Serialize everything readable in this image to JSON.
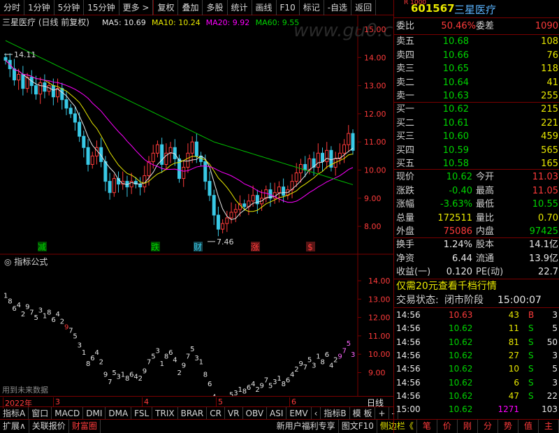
{
  "toolbar": {
    "tabs": [
      "分时",
      "1分钟",
      "5分钟",
      "15分钟",
      "更多 >"
    ],
    "tools": [
      "复权",
      "叠加",
      "多股",
      "统计",
      "画线",
      "F10",
      "标记",
      "-自选",
      "返回"
    ]
  },
  "main_chart": {
    "title": "三星医疗 (日线 前复权)",
    "ma_labels": [
      {
        "text": "MA5: 10.69",
        "color": "#e8e8e8"
      },
      {
        "text": "MA10: 10.24",
        "color": "#e8e800"
      },
      {
        "text": "MA20: 9.92",
        "color": "#ff00ff"
      },
      {
        "text": "MA60: 9.55",
        "color": "#00d400"
      }
    ],
    "y_ticks": [
      "15.00",
      "14.00",
      "13.00",
      "12.00",
      "11.00",
      "10.00",
      "9.00",
      "8.00"
    ],
    "high_label": "14.11",
    "low_label": "7.46",
    "markers": [
      "减",
      "跌",
      "财",
      "涨",
      "$"
    ],
    "watermark": "www.gu0.cn"
  },
  "indicator": {
    "title": "指标公式",
    "y_ticks": [
      "14.00",
      "13.00",
      "12.00",
      "11.00",
      "10.00",
      "9.00"
    ],
    "footer_note": "用到未来数据"
  },
  "x_axis": [
    "2022年",
    "3",
    "4",
    "5",
    "6"
  ],
  "x_right": "日线",
  "bottom_tabs": [
    "指标A",
    "窗口",
    "MACD",
    "DMI",
    "DMA",
    "FSL",
    "TRIX",
    "BRAR",
    "CR",
    "VR",
    "OBV",
    "ASI",
    "EMV",
    "‹",
    "指标B",
    "模 板",
    "+",
    "-"
  ],
  "status_bar": [
    "扩展∧",
    "关联报价",
    "财富圈"
  ],
  "status_right": [
    "新用户福利专享",
    "图文F10",
    "侧边栏《"
  ],
  "status_icons": [
    "笔",
    "价",
    "刚",
    "分",
    "势",
    "值",
    "主"
  ],
  "quote": {
    "badge": "R 1000",
    "code": "601567",
    "name": "三星医疗",
    "weibi_label": "委比",
    "weibi": "50.46%",
    "weicha_label": "委差",
    "weicha": "1090",
    "asks": [
      {
        "label": "卖五",
        "price": "10.68",
        "vol": "108"
      },
      {
        "label": "卖四",
        "price": "10.66",
        "vol": "76"
      },
      {
        "label": "卖三",
        "price": "10.65",
        "vol": "118"
      },
      {
        "label": "卖二",
        "price": "10.64",
        "vol": "41"
      },
      {
        "label": "卖一",
        "price": "10.63",
        "vol": "255"
      }
    ],
    "bids": [
      {
        "label": "买一",
        "price": "10.62",
        "vol": "215"
      },
      {
        "label": "买二",
        "price": "10.61",
        "vol": "221"
      },
      {
        "label": "买三",
        "price": "10.60",
        "vol": "459"
      },
      {
        "label": "买四",
        "price": "10.59",
        "vol": "565"
      },
      {
        "label": "买五",
        "price": "10.58",
        "vol": "165"
      }
    ],
    "stats": [
      {
        "l1": "现价",
        "v1": "10.62",
        "c1": "grn",
        "l2": "今开",
        "v2": "11.03",
        "c2": "red"
      },
      {
        "l1": "涨跌",
        "v1": "-0.40",
        "c1": "grn",
        "l2": "最高",
        "v2": "11.05",
        "c2": "red"
      },
      {
        "l1": "涨幅",
        "v1": "-3.63%",
        "c1": "grn",
        "l2": "最低",
        "v2": "10.55",
        "c2": "grn"
      },
      {
        "l1": "总量",
        "v1": "172511",
        "c1": "yel",
        "l2": "量比",
        "v2": "0.70",
        "c2": "yel"
      },
      {
        "l1": "外盘",
        "v1": "75086",
        "c1": "red",
        "l2": "内盘",
        "v2": "97425",
        "c2": "grn"
      }
    ],
    "stats2": [
      {
        "l1": "换手",
        "v1": "1.24%",
        "l2": "股本",
        "v2": "14.1亿"
      },
      {
        "l1": "净资",
        "v1": "6.44",
        "l2": "流通",
        "v2": "13.9亿"
      },
      {
        "l1": "收益(一)",
        "v1": "0.120",
        "l2": "PE(动)",
        "v2": "22.7"
      }
    ],
    "promo": "仅需20元查看千档行情",
    "status_label": "交易状态:",
    "status_value": "闭市阶段",
    "status_time": "15:00:07",
    "ticks": [
      {
        "t": "14:56",
        "p": "10.63",
        "v": "43",
        "d": "B",
        "n": "3",
        "pc": "red",
        "dc": "red"
      },
      {
        "t": "14:56",
        "p": "10.62",
        "v": "11",
        "d": "S",
        "n": "5",
        "pc": "grn",
        "dc": "grn"
      },
      {
        "t": "14:56",
        "p": "10.62",
        "v": "81",
        "d": "S",
        "n": "50",
        "pc": "grn",
        "dc": "grn"
      },
      {
        "t": "14:56",
        "p": "10.62",
        "v": "27",
        "d": "S",
        "n": "3",
        "pc": "grn",
        "dc": "grn"
      },
      {
        "t": "14:56",
        "p": "10.62",
        "v": "10",
        "d": "S",
        "n": "5",
        "pc": "grn",
        "dc": "grn"
      },
      {
        "t": "14:56",
        "p": "10.62",
        "v": "6",
        "d": "S",
        "n": "3",
        "pc": "grn",
        "dc": "grn"
      },
      {
        "t": "14:56",
        "p": "10.62",
        "v": "47",
        "d": "S",
        "n": "22",
        "pc": "grn",
        "dc": "grn"
      },
      {
        "t": "15:00",
        "p": "10.62",
        "v": "1271",
        "d": "",
        "n": "103",
        "pc": "grn",
        "dc": "grn"
      }
    ]
  }
}
